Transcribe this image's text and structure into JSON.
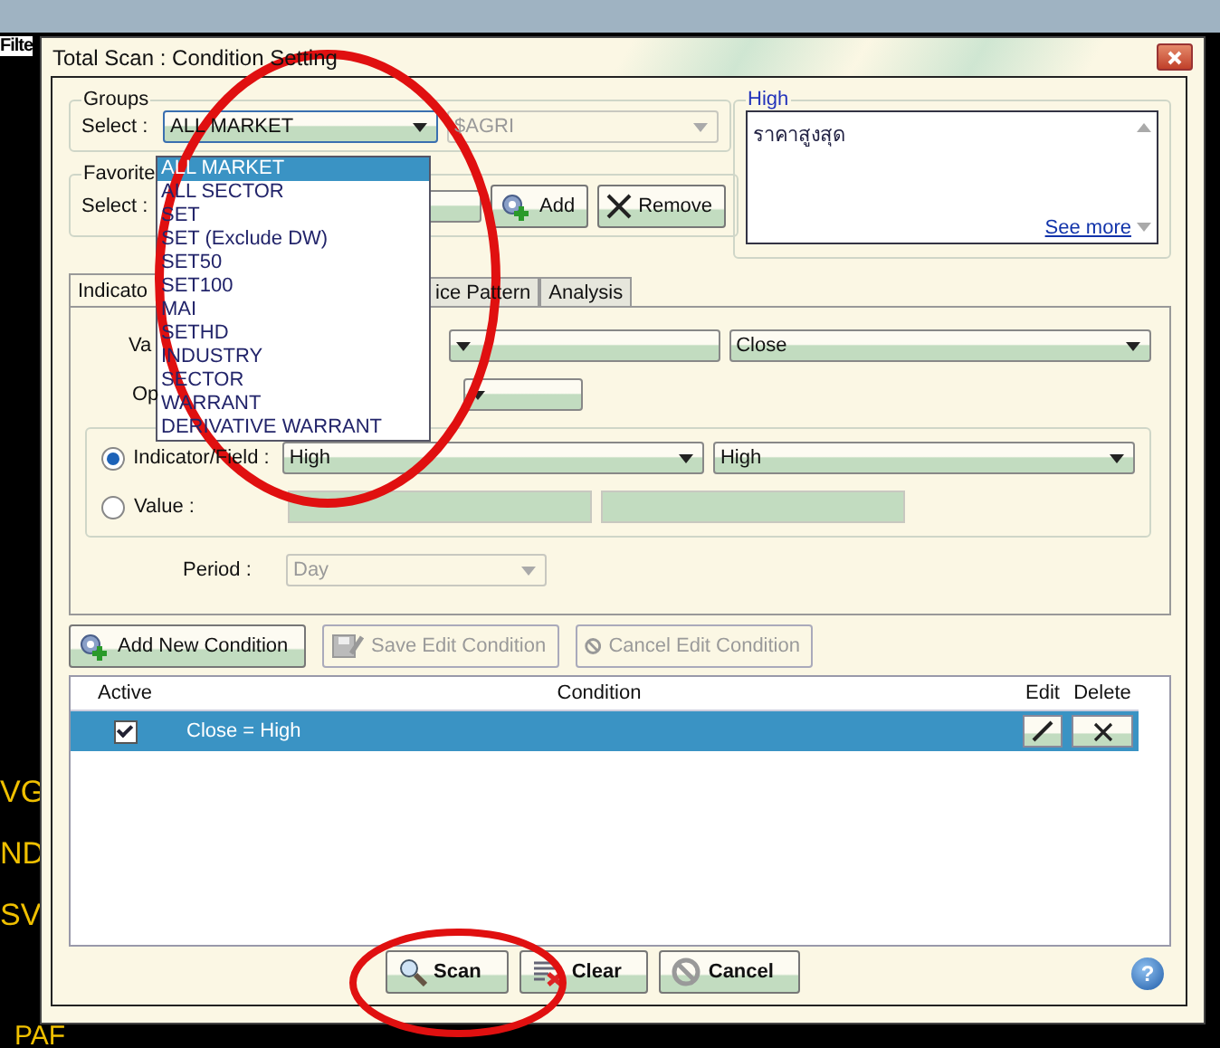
{
  "background": {
    "toolbar_label": "Filte",
    "ticker_fragments": [
      "VG",
      "ND",
      "SV"
    ],
    "news_fragment": "PAF"
  },
  "dialog": {
    "title": "Total Scan : Condition Setting"
  },
  "groups": {
    "legend": "Groups",
    "select_label": "Select :",
    "group_value": "ALL MARKET",
    "sub_value": "$AGRI",
    "sub_disabled": true
  },
  "group_dropdown": [
    {
      "label": "ALL MARKET",
      "selected": true
    },
    {
      "label": "ALL SECTOR",
      "selected": false
    },
    {
      "label": "SET",
      "selected": false
    },
    {
      "label": "SET (Exclude DW)",
      "selected": false
    },
    {
      "label": "SET50",
      "selected": false
    },
    {
      "label": "SET100",
      "selected": false
    },
    {
      "label": "MAI",
      "selected": false
    },
    {
      "label": "SETHD",
      "selected": false
    },
    {
      "label": "INDUSTRY",
      "selected": false
    },
    {
      "label": "SECTOR",
      "selected": false
    },
    {
      "label": "WARRANT",
      "selected": false
    },
    {
      "label": "DERIVATIVE WARRANT",
      "selected": false
    }
  ],
  "favorites": {
    "legend": "Favorite",
    "select_label": "Select :",
    "buttons": [
      {
        "label": "Add",
        "kind": "add"
      },
      {
        "label": "Remove",
        "kind": "remove"
      }
    ]
  },
  "description": {
    "legend": "High",
    "text": "ราคาสูงสุด",
    "link": "See more"
  },
  "tabs": [
    {
      "label": "Indicato",
      "selected": true
    },
    {
      "label": "ice Pattern",
      "selected": false
    },
    {
      "label": "Analysis",
      "selected": false
    }
  ],
  "tab_panel": {
    "value_label": "Va",
    "value_right": "Close",
    "operator_label": "Op",
    "sources": [
      {
        "label": "Indicator/Field :",
        "selected": true,
        "kind": "combos",
        "values": [
          "High",
          "High"
        ]
      },
      {
        "label": "Value :",
        "selected": false,
        "kind": "inputs"
      }
    ],
    "period": {
      "label": "Period :",
      "value": "Day",
      "disabled": true
    }
  },
  "condition_buttons": [
    {
      "label": "Add New Condition",
      "kind": "add",
      "disabled": false
    },
    {
      "label": "Save Edit Condition",
      "kind": "save",
      "disabled": true
    },
    {
      "label": "Cancel Edit Condition",
      "kind": "cancel",
      "disabled": true
    }
  ],
  "conditions": {
    "columns": [
      "Active",
      "Condition",
      "Edit",
      "Delete"
    ],
    "rows": [
      {
        "active": true,
        "condition": "Close = High",
        "selected": true
      }
    ]
  },
  "footer_buttons": [
    {
      "label": "Scan",
      "kind": "scan"
    },
    {
      "label": "Clear",
      "kind": "clear"
    },
    {
      "label": "Cancel",
      "kind": "cancel"
    }
  ],
  "help": "?"
}
